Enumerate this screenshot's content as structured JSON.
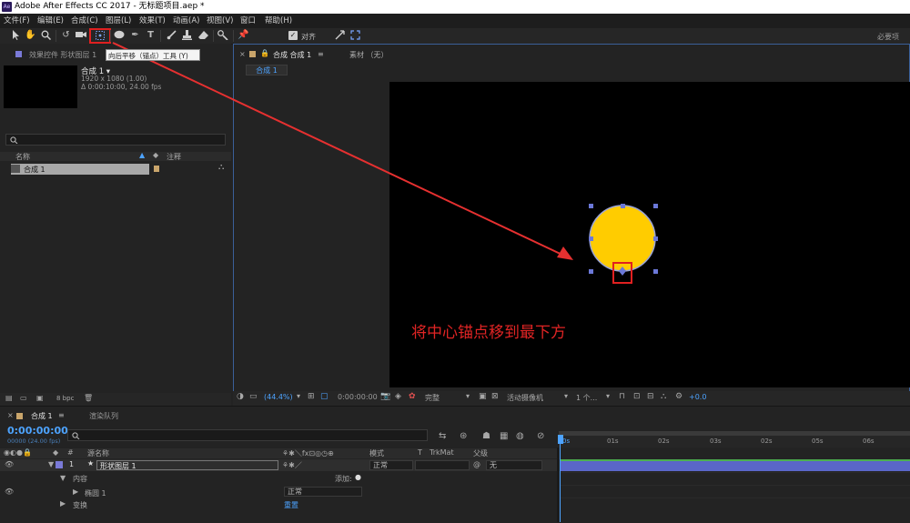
{
  "window": {
    "title": "Adobe After Effects CC 2017 - 无标题项目.aep *",
    "app_icon": "Ae"
  },
  "menu": [
    "文件(F)",
    "编辑(E)",
    "合成(C)",
    "图层(L)",
    "效果(T)",
    "动画(A)",
    "视图(V)",
    "窗口",
    "帮助(H)"
  ],
  "toolbar": {
    "snap_label": "对齐",
    "workspace_label": "必要项",
    "tooltip": "向后平移（锚点）工具 (Y)"
  },
  "project_panel": {
    "tab_effects": "效果控件 形状图层 1",
    "comp_name": "合成 1 ▾",
    "comp_res": "1920 x 1080 (1.00)",
    "comp_dur": "Δ 0:00:10:00, 24.00 fps",
    "col_name": "名称",
    "col_comment": "注释",
    "item_name": "合成 1",
    "bpc": "8 bpc"
  },
  "viewer": {
    "tab_comp": "合成 合成 1",
    "tab_footage": "素材 （无）",
    "comp_chip": "合成 1",
    "zoom": "(44.4%)",
    "timecode": "0:00:00:00",
    "quality": "完整",
    "camera": "活动摄像机",
    "views": "1 个...",
    "exposure": "+0.0"
  },
  "annotation": {
    "text": "将中心锚点移到最下方"
  },
  "timeline": {
    "tab_comp": "合成 1",
    "tab_render": "渲染队列",
    "timecode": "0:00:00:00",
    "fps": "00000 (24.00 fps)",
    "col_num": "#",
    "col_source": "源名称",
    "col_mode": "模式",
    "col_t": "T",
    "col_trkmat": "TrkMat",
    "col_parent": "父级",
    "layer_num": "1",
    "layer_name": "形状图层 1",
    "layer_mode": "正常",
    "layer_parent": "无",
    "contents": "内容",
    "add": "添加:",
    "ellipse": "椭圆 1",
    "ellipse_mode": "正常",
    "transform": "变换",
    "reset": "重置",
    "ticks": [
      "0s",
      "01s",
      "02s",
      "03s",
      "02s",
      "05s",
      "06s"
    ]
  },
  "colors": {
    "accent": "#4da3ff",
    "circle_fill": "#ffcc00",
    "annotation": "#e02424",
    "track": "#5a66c8",
    "label_purple": "#7a7ad8"
  }
}
